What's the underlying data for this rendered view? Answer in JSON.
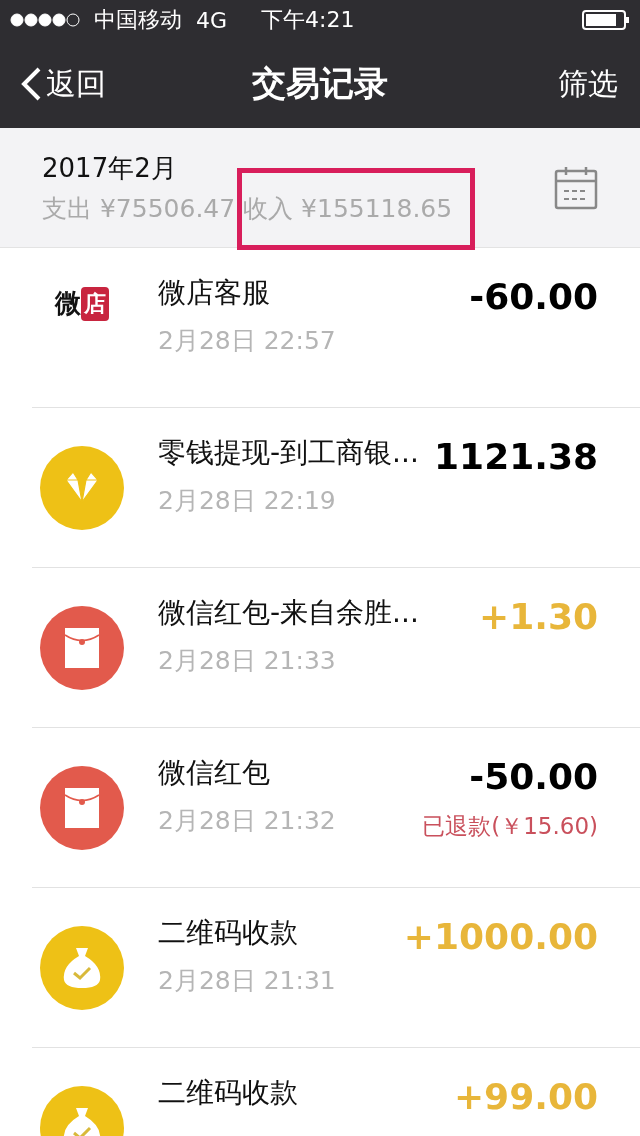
{
  "status_bar": {
    "carrier": "中国移动",
    "network": "4G",
    "time": "下午4:21"
  },
  "nav": {
    "back": "返回",
    "title": "交易记录",
    "action": "筛选"
  },
  "summary": {
    "month": "2017年2月",
    "expense": "支出 ¥75506.47",
    "income": "收入 ¥155118.65",
    "annotation": {
      "kind": "rectangle"
    }
  },
  "transactions": [
    {
      "kind": "logo",
      "logo": [
        "微",
        "店"
      ],
      "title": "微店客服",
      "time": "2月28日 22:57",
      "amount": "-60.00",
      "income": false
    },
    {
      "kind": "diamond",
      "title": "零钱提现-到工商银...",
      "time": "2月28日 22:19",
      "amount": "1121.38",
      "income": false
    },
    {
      "kind": "red-packet",
      "title": "微信红包-来自余胜...",
      "time": "2月28日 21:33",
      "amount": "+1.30",
      "income": true
    },
    {
      "kind": "red-packet",
      "title": "微信红包",
      "time": "2月28日 21:32",
      "amount": "-50.00",
      "income": false,
      "note": "已退款(￥15.60)"
    },
    {
      "kind": "money-bag",
      "title": "二维码收款",
      "time": "2月28日 21:31",
      "amount": "+1000.00",
      "income": true
    },
    {
      "kind": "money-bag",
      "title": "二维码收款",
      "amount": "+99.00",
      "income": true
    }
  ]
}
